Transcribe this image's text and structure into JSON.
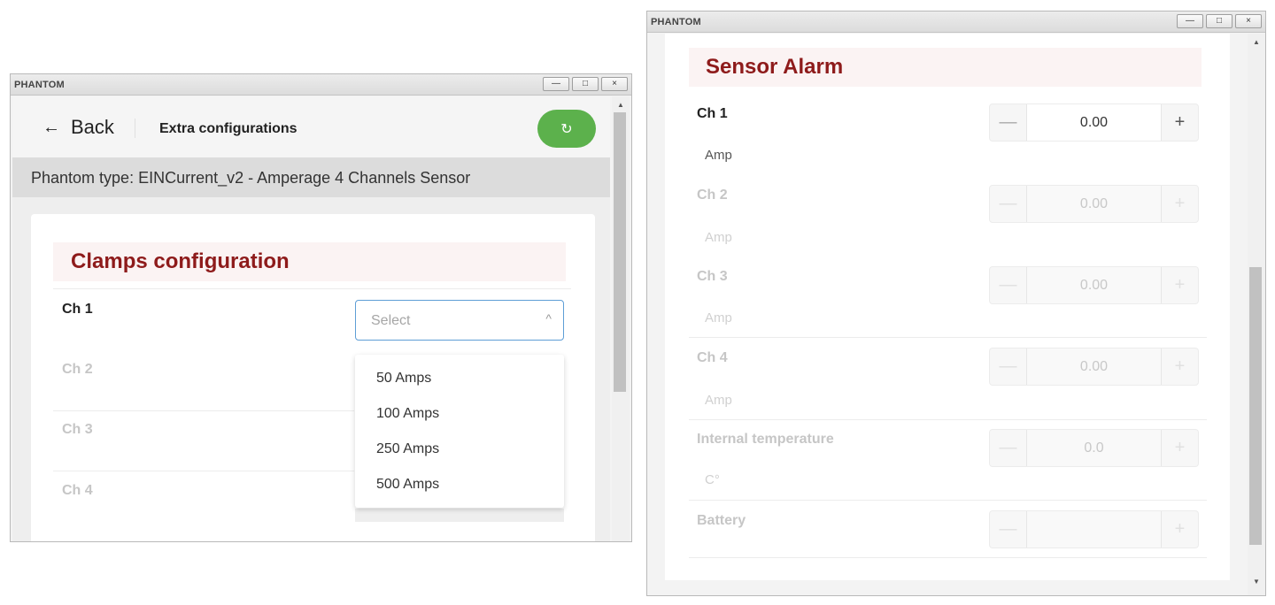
{
  "left_window": {
    "title": "PHANTOM",
    "controls": {
      "minimize": "—",
      "maximize": "□",
      "close": "×"
    },
    "back_arrow": "←",
    "back_label": "Back",
    "page_title": "Extra configurations",
    "refresh_icon": "↻",
    "refresh_color": "#5cb14c",
    "phantom_type": "Phantom type: EINCurrent_v2 - Amperage 4 Channels Sensor",
    "section_title": "Clamps configuration",
    "section_color": "#8e1b1b",
    "channels": [
      "Ch 1",
      "Ch 2",
      "Ch 3",
      "Ch 4"
    ],
    "select": {
      "placeholder": "Select",
      "chevron": "^"
    },
    "options": [
      "50 Amps",
      "100 Amps",
      "250 Amps",
      "500 Amps"
    ]
  },
  "right_window": {
    "title": "PHANTOM",
    "controls": {
      "minimize": "—",
      "maximize": "□",
      "close": "×"
    },
    "section_title": "Sensor Alarm",
    "stepper_minus": "—",
    "stepper_plus": "+",
    "fields": [
      {
        "label": "Ch 1",
        "value": "0.00",
        "unit": "Amp"
      },
      {
        "label": "Ch 2",
        "value": "0.00",
        "unit": "Amp"
      },
      {
        "label": "Ch 3",
        "value": "0.00",
        "unit": "Amp"
      },
      {
        "label": "Ch 4",
        "value": "0.00",
        "unit": "Amp"
      },
      {
        "label": "Internal temperature",
        "value": "0.0",
        "unit": "C°"
      },
      {
        "label": "Battery",
        "value": "",
        "unit": ""
      }
    ]
  }
}
